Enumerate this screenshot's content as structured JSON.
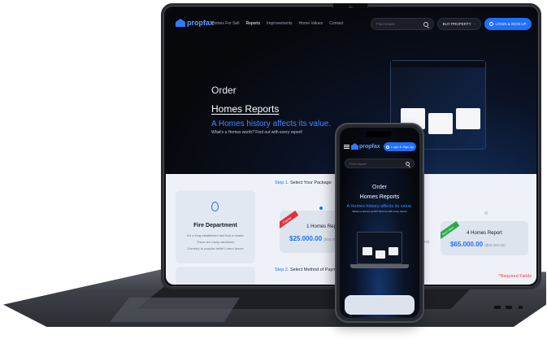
{
  "laptop": {
    "nav": {
      "logo": "propfax",
      "links": [
        "Homes For Sell",
        "Reports",
        "Improvements",
        "Home Values",
        "Contact"
      ],
      "search_placeholder": "Find House",
      "buy_label": "BUY PROPERTY",
      "login_label": "LOGIN & SIGN UP"
    },
    "hero": {
      "order": "Order",
      "title": "Homes Reports",
      "subtitle": "A Homes history affects its value.",
      "description": "What's a Homes worth? Find out with every report!"
    },
    "section": {
      "step1_num": "Step 1.",
      "step1_text": "Select Your Package",
      "fire_card": {
        "title": "Fire Department",
        "lines": [
          "It's a long established fact that a reader",
          "There are many variations",
          "Contrary to popular belief Lorem Ipsum"
        ]
      },
      "packages": [
        {
          "name": "1 Homes Report",
          "price": "$25.000.00",
          "old_price": "($25.000.00)",
          "ribbon": "Popular",
          "ribbon_color": "#e0323c"
        },
        {
          "name": "4 Homes Report",
          "price": "$65.000.00",
          "old_price": "($65.000.00)",
          "ribbon": "Best Value",
          "ribbon_color": "#2aa84a"
        }
      ],
      "hidden_old_price": "00)",
      "step2_num": "Step 2.",
      "step2_text": "Select Method of Paym",
      "required": "*Required Fields"
    }
  },
  "phone": {
    "logo": "propfax",
    "login_label": "Login & Sign Up",
    "search_placeholder": "Find House",
    "order": "Order",
    "title": "Homes Reports",
    "subtitle": "A Homes history affects its value.",
    "description": "What's a Homes worth? Find out with every report!"
  },
  "colors": {
    "accent": "#1f6fff",
    "required": "#ff3b3b"
  }
}
